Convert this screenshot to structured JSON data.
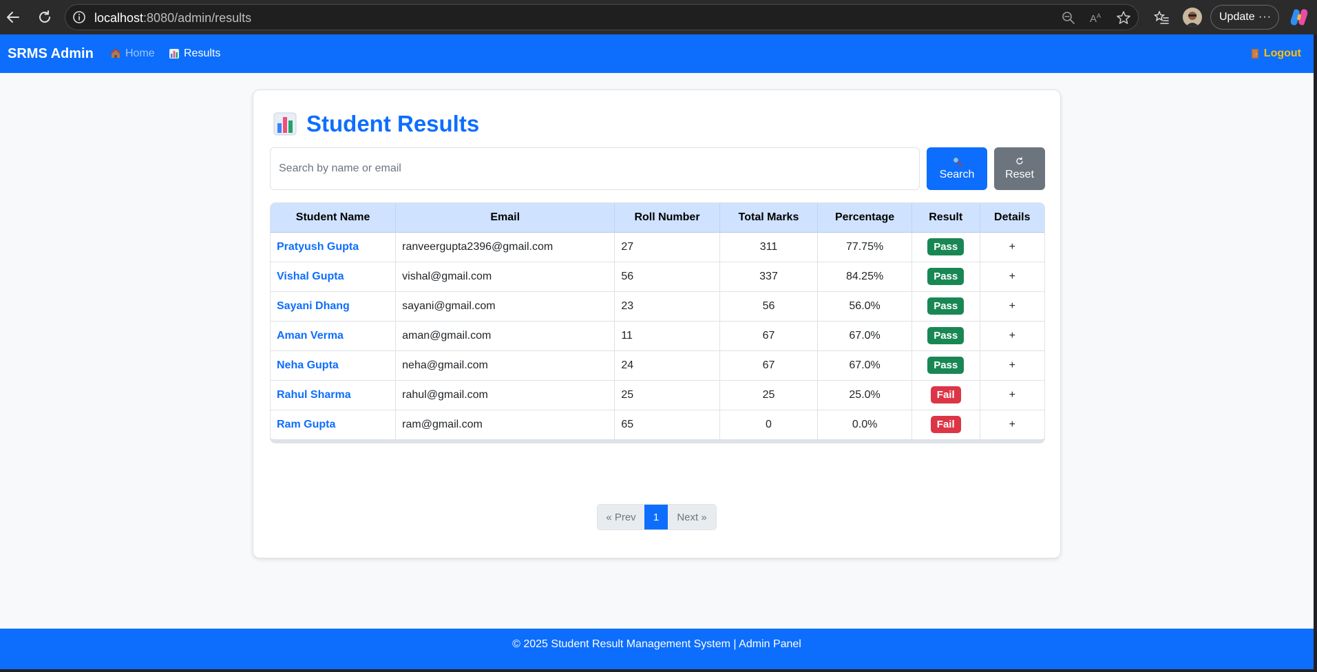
{
  "browser": {
    "url_host": "localhost",
    "url_rest": ":8080/admin/results",
    "update_label": "Update",
    "more_label": "···"
  },
  "navbar": {
    "brand": "SRMS Admin",
    "links": [
      {
        "label": "Home",
        "icon": "house-icon"
      },
      {
        "label": "Results",
        "icon": "bar-chart-icon"
      }
    ],
    "logout": "Logout",
    "logout_icon": "door-icon",
    "bg_color": "#0d6efd",
    "logout_color": "#ffc107"
  },
  "card": {
    "title": "Student Results",
    "title_icon": "bar-chart-icon"
  },
  "search": {
    "placeholder": "Search by name or email",
    "value": "",
    "search_label": "Search",
    "search_icon": "magnifier-icon",
    "reset_label": "Reset",
    "reset_icon": "refresh-icon"
  },
  "table": {
    "headers": [
      "Student Name",
      "Email",
      "Roll Number",
      "Total Marks",
      "Percentage",
      "Result",
      "Details"
    ],
    "rows": [
      {
        "name": "Pratyush Gupta",
        "email": "ranveergupta2396@gmail.com",
        "roll": "27",
        "marks": "311",
        "percent": "77.75%",
        "result": "Pass",
        "details": "+"
      },
      {
        "name": "Vishal Gupta",
        "email": "vishal@gmail.com",
        "roll": "56",
        "marks": "337",
        "percent": "84.25%",
        "result": "Pass",
        "details": "+"
      },
      {
        "name": "Sayani Dhang",
        "email": "sayani@gmail.com",
        "roll": "23",
        "marks": "56",
        "percent": "56.0%",
        "result": "Pass",
        "details": "+"
      },
      {
        "name": "Aman Verma",
        "email": "aman@gmail.com",
        "roll": "11",
        "marks": "67",
        "percent": "67.0%",
        "result": "Pass",
        "details": "+"
      },
      {
        "name": "Neha Gupta",
        "email": "neha@gmail.com",
        "roll": "24",
        "marks": "67",
        "percent": "67.0%",
        "result": "Pass",
        "details": "+"
      },
      {
        "name": "Rahul Sharma",
        "email": "rahul@gmail.com",
        "roll": "25",
        "marks": "25",
        "percent": "25.0%",
        "result": "Fail",
        "details": "+"
      },
      {
        "name": "Ram Gupta",
        "email": "ram@gmail.com",
        "roll": "65",
        "marks": "0",
        "percent": "0.0%",
        "result": "Fail",
        "details": "+"
      }
    ],
    "pass_color": "#198754",
    "fail_color": "#dc3545"
  },
  "pagination": {
    "prev": "« Prev",
    "current": "1",
    "next": "Next »"
  },
  "footer": {
    "text": "© 2025 Student Result Management System | Admin Panel"
  }
}
